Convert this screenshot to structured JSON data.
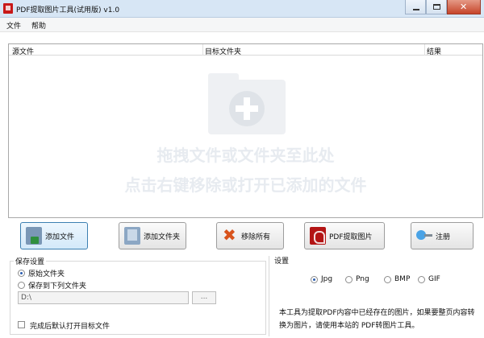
{
  "window": {
    "title": "PDF提取图片工具(试用版) v1.0"
  },
  "menu": {
    "items": [
      "文件",
      "帮助"
    ]
  },
  "list": {
    "columns": [
      "源文件",
      "目标文件夹",
      "结果"
    ],
    "hint_line1": "拖拽文件或文件夹至此处",
    "hint_line2": "点击右键移除或打开已添加的文件"
  },
  "buttons": {
    "add_file": "添加文件",
    "add_folder": "添加文件夹",
    "remove_all": "移除所有",
    "extract": "PDF提取图片",
    "register": "注册"
  },
  "save_settings": {
    "legend": "保存设置",
    "option_original": "原始文件夹",
    "option_below": "保存到下列文件夹",
    "selected": "原始文件夹",
    "path_value": "D:\\",
    "browse_label": "...",
    "open_after_label": "完成后默认打开目标文件"
  },
  "settings": {
    "legend": "设置",
    "formats": [
      "Jpg",
      "Png",
      "BMP",
      "GIF"
    ],
    "selected_format": "Jpg",
    "description": "本工具为提取PDF内容中已经存在的图片，如果要整页内容转换为图片，请使用本站的 PDF转图片工具。"
  },
  "colors": {
    "titlebar": "#d7e6f5",
    "close_button": "#c6442a",
    "hint_text": "#e7ebf0",
    "focus_border": "#3c7fb1"
  }
}
